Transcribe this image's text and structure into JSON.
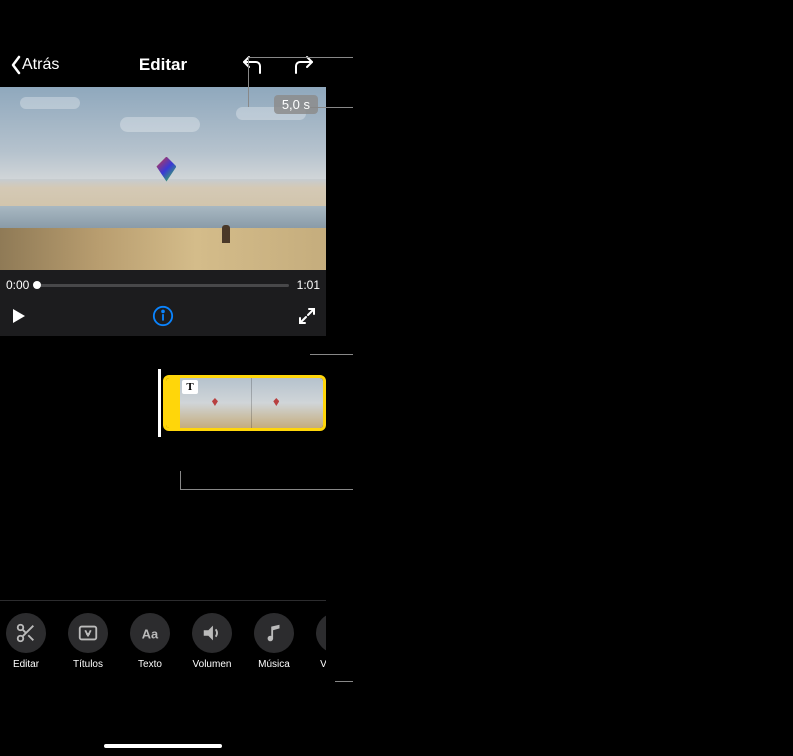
{
  "topbar": {
    "back_label": "Atrás",
    "title": "Editar"
  },
  "preview": {
    "duration_badge": "5,0 s",
    "current_time": "0:00",
    "total_time": "1:01"
  },
  "timeline": {
    "title_badge": "T"
  },
  "tools": [
    {
      "id": "edit",
      "label": "Editar"
    },
    {
      "id": "titles",
      "label": "Títulos"
    },
    {
      "id": "text",
      "label": "Texto"
    },
    {
      "id": "volume",
      "label": "Volumen"
    },
    {
      "id": "music",
      "label": "Música"
    },
    {
      "id": "more",
      "label": "Ve"
    }
  ]
}
